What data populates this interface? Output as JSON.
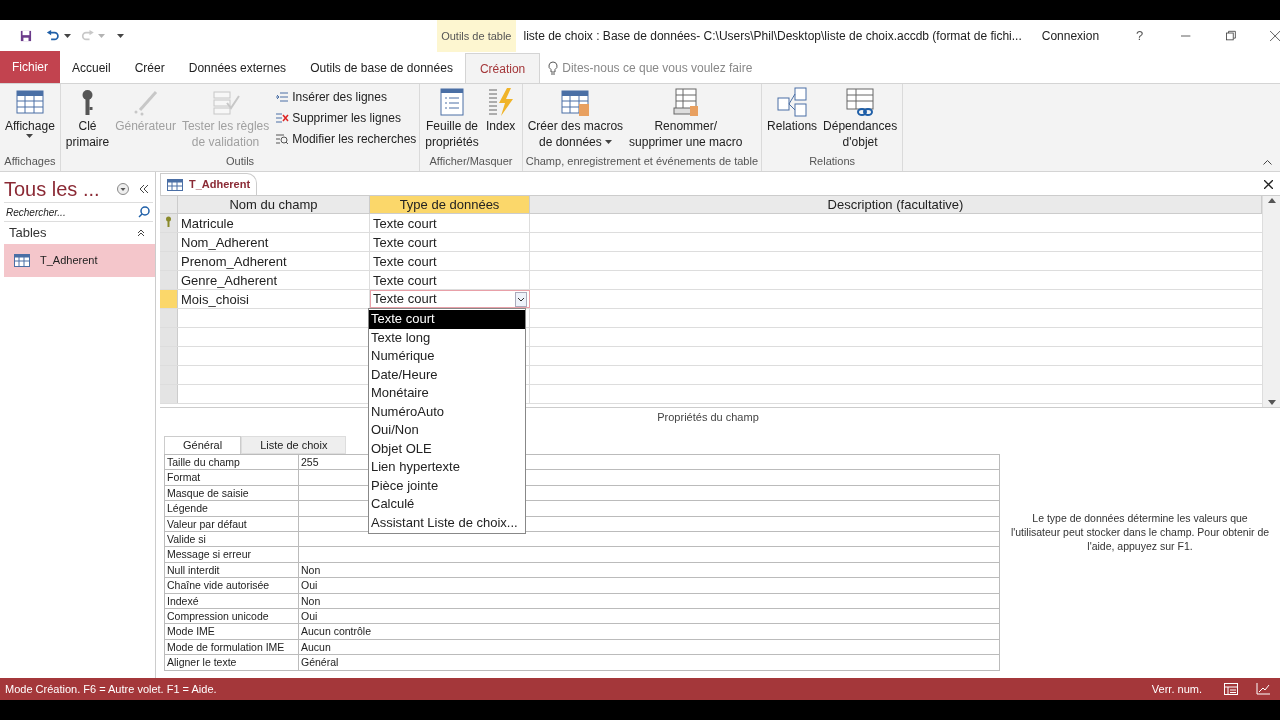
{
  "title_bar": {
    "context_tab": "Outils de table",
    "title": "liste de choix : Base de données- C:\\Users\\Phil\\Desktop\\liste de choix.accdb (format de fichi...",
    "account": "Connexion",
    "help": "?"
  },
  "menu_tabs": [
    {
      "label": "Fichier",
      "kind": "file",
      "selected": false
    },
    {
      "label": "Accueil",
      "kind": "tab",
      "selected": false
    },
    {
      "label": "Créer",
      "kind": "tab",
      "selected": false
    },
    {
      "label": "Données externes",
      "kind": "tab",
      "selected": false
    },
    {
      "label": "Outils de base de données",
      "kind": "tab",
      "selected": false
    },
    {
      "label": "Création",
      "kind": "tab",
      "selected": true
    }
  ],
  "tell_me": {
    "placeholder": "Dites-nous ce que vous voulez faire"
  },
  "ribbon_groups": [
    {
      "label": "Affichages",
      "buttons": [
        {
          "kind": "large",
          "lines": [
            "Affichage"
          ],
          "disabled": false,
          "dropdown": true
        }
      ]
    },
    {
      "label": "Outils",
      "buttons": [
        {
          "kind": "large",
          "lines": [
            "Clé",
            "primaire"
          ],
          "disabled": false,
          "dropdown": false
        },
        {
          "kind": "large",
          "lines": [
            "Générateur"
          ],
          "disabled": true,
          "dropdown": false
        },
        {
          "kind": "large",
          "lines": [
            "Tester les règles",
            "de validation"
          ],
          "disabled": true,
          "dropdown": false
        },
        {
          "kind": "small",
          "lines": [
            "Insérer des lignes"
          ],
          "disabled": false
        },
        {
          "kind": "small",
          "lines": [
            "Supprimer les lignes"
          ],
          "disabled": false
        },
        {
          "kind": "small",
          "lines": [
            "Modifier les recherches"
          ],
          "disabled": false
        }
      ]
    },
    {
      "label": "Afficher/Masquer",
      "buttons": [
        {
          "kind": "large",
          "lines": [
            "Feuille de",
            "propriétés"
          ],
          "disabled": false,
          "dropdown": false
        },
        {
          "kind": "large",
          "lines": [
            "Index"
          ],
          "disabled": false,
          "dropdown": false
        }
      ]
    },
    {
      "label": "Champ, enregistrement et événements de table",
      "buttons": [
        {
          "kind": "large",
          "lines": [
            "Créer des macros",
            "de données"
          ],
          "disabled": false,
          "dropdown": true
        },
        {
          "kind": "large",
          "lines": [
            "Renommer/",
            "supprimer une macro"
          ],
          "disabled": false,
          "dropdown": false
        }
      ]
    },
    {
      "label": "Relations",
      "buttons": [
        {
          "kind": "large",
          "lines": [
            "Relations"
          ],
          "disabled": false,
          "dropdown": false
        },
        {
          "kind": "large",
          "lines": [
            "Dépendances",
            "d'objet"
          ],
          "disabled": false,
          "dropdown": false
        }
      ]
    }
  ],
  "nav_pane": {
    "title": "Tous les ...",
    "search": {
      "placeholder": "Rechercher..."
    },
    "section": "Tables",
    "items": [
      {
        "label": "T_Adherent",
        "selected": true
      }
    ]
  },
  "document_tab": "T_Adherent",
  "table": {
    "columns": [
      {
        "label": "Nom du champ",
        "selected": false
      },
      {
        "label": "Type de données",
        "selected": true
      },
      {
        "label": "Description (facultative)",
        "selected": false
      }
    ],
    "rows": [
      {
        "name": "Matricule",
        "type": "Texte court",
        "primary_key": true,
        "current": false
      },
      {
        "name": "Nom_Adherent",
        "type": "Texte court",
        "primary_key": false,
        "current": false
      },
      {
        "name": "Prenom_Adherent",
        "type": "Texte court",
        "primary_key": false,
        "current": false
      },
      {
        "name": "Genre_Adherent",
        "type": "Texte court",
        "primary_key": false,
        "current": false
      },
      {
        "name": "Mois_choisi",
        "type": "Texte court",
        "primary_key": false,
        "current": true
      }
    ]
  },
  "type_dropdown": [
    {
      "label": "Texte court",
      "selected": true
    },
    {
      "label": "Texte long",
      "selected": false
    },
    {
      "label": "Numérique",
      "selected": false
    },
    {
      "label": "Date/Heure",
      "selected": false
    },
    {
      "label": "Monétaire",
      "selected": false
    },
    {
      "label": "NuméroAuto",
      "selected": false
    },
    {
      "label": "Oui/Non",
      "selected": false
    },
    {
      "label": "Objet OLE",
      "selected": false
    },
    {
      "label": "Lien hypertexte",
      "selected": false
    },
    {
      "label": "Pièce jointe",
      "selected": false
    },
    {
      "label": "Calculé",
      "selected": false
    },
    {
      "label": "Assistant Liste de choix...",
      "selected": false
    }
  ],
  "field_properties": {
    "title": "Propriétés du champ",
    "tabs": [
      {
        "label": "Général",
        "selected": true
      },
      {
        "label": "Liste de choix",
        "selected": false
      }
    ],
    "rows": [
      {
        "label": "Taille du champ",
        "value": "255"
      },
      {
        "label": "Format"
      },
      {
        "label": "Masque de saisie"
      },
      {
        "label": "Légende"
      },
      {
        "label": "Valeur par défaut"
      },
      {
        "label": "Valide si"
      },
      {
        "label": "Message si erreur"
      },
      {
        "label": "Null interdit",
        "value": "Non"
      },
      {
        "label": "Chaîne vide autorisée",
        "value": "Oui"
      },
      {
        "label": "Indexé",
        "value": "Non"
      },
      {
        "label": "Compression unicode",
        "value": "Oui"
      },
      {
        "label": "Mode IME",
        "value": "Aucun contrôle"
      },
      {
        "label": "Mode de formulation IME",
        "value": "Aucun"
      },
      {
        "label": "Aligner le texte",
        "value": "Général"
      }
    ],
    "help": "Le type de données détermine les valeurs que l'utilisateur peut stocker dans le champ. Pour obtenir de l'aide, appuyez sur F1."
  },
  "status_bar": {
    "left": "Mode Création. F6 = Autre volet. F1 = Aide.",
    "right": "Verr. num."
  }
}
